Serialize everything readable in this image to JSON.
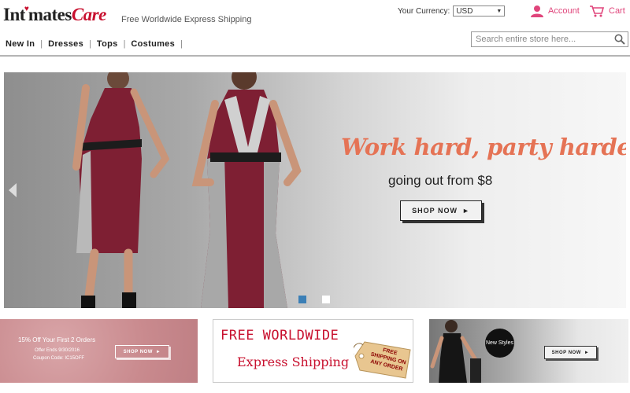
{
  "header": {
    "logo_part1": "Int",
    "logo_part2": "mates",
    "logo_part3": "Care",
    "tagline": "Free Worldwide Express Shipping",
    "currency_label": "Your Currency:",
    "currency_value": "USD",
    "account_label": "Account",
    "cart_label": "Cart",
    "account_icon": "person-icon",
    "cart_icon": "shopping-cart-icon",
    "accent_color": "#e0457b",
    "brand_color": "#c8102e"
  },
  "nav": {
    "items": [
      {
        "label": "New In"
      },
      {
        "label": "Dresses"
      },
      {
        "label": "Tops"
      },
      {
        "label": "Costumes"
      }
    ],
    "separator": "|"
  },
  "search": {
    "placeholder": "Search entire store here...",
    "icon": "magnifier-icon"
  },
  "hero": {
    "headline": "Work hard, party harder!",
    "subline": "going out from $8",
    "button_label": "SHOP NOW",
    "button_arrow": "►",
    "prev_icon": "arrow-left-icon",
    "slides_total": 2,
    "active_slide": 1,
    "headline_color": "#e57355",
    "dot_active_color": "#3b7fb6"
  },
  "banners": {
    "promo": {
      "line1": "15% Off Your First 2 Orders",
      "line2": "Offer Ends 9/30/2016",
      "line3": "Coupon Code: IC15OFF",
      "button_label": "SHOP NOW",
      "button_arrow": "►"
    },
    "shipping": {
      "line1": "FREE WORLDWIDE",
      "line2": "Express Shipping",
      "tag_text": "FREE SHIPPING ON ANY ORDER"
    },
    "styles": {
      "badge": "New Styles",
      "button_label": "SHOP NOW",
      "button_arrow": "►"
    }
  }
}
